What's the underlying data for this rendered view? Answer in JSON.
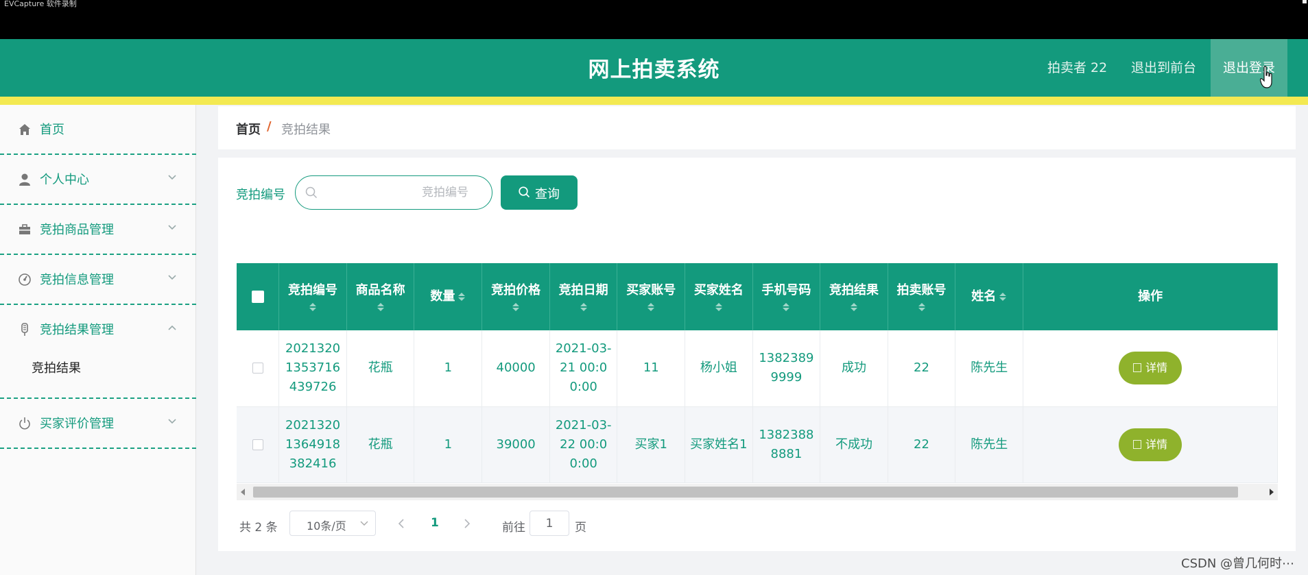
{
  "window": {
    "caption": "EVCapture 软件录制"
  },
  "header": {
    "title": "网上拍卖系统",
    "user_label": "拍卖者 22",
    "back_front": "退出到前台",
    "logout": "退出登录",
    "bg_color": "#139a7d",
    "strip_color": "#f3e952"
  },
  "sidebar": {
    "items": [
      {
        "label": "首页",
        "icon": "home-icon"
      },
      {
        "label": "个人中心",
        "icon": "user-icon"
      },
      {
        "label": "竞拍商品管理",
        "icon": "briefcase-icon"
      },
      {
        "label": "竞拍信息管理",
        "icon": "gauge-icon"
      },
      {
        "label": "竞拍结果管理",
        "icon": "mic-icon"
      },
      {
        "label": "买家评价管理",
        "icon": "power-icon"
      }
    ],
    "subitem": "竞拍结果"
  },
  "breadcrumb": {
    "home": "首页",
    "separator": "/",
    "current": "竞拍结果"
  },
  "search": {
    "label": "竞拍编号",
    "placeholder": "竞拍编号",
    "value": "",
    "button": "查询"
  },
  "table": {
    "headers": {
      "code": "竞拍编号",
      "product": "商品名称",
      "qty": "数量",
      "price": "竞拍价格",
      "date": "竞拍日期",
      "buyer_acct": "买家账号",
      "buyer_name": "买家姓名",
      "phone": "手机号码",
      "result": "竞拍结果",
      "seller_acct": "拍卖账号",
      "name": "姓名",
      "ops": "操作"
    },
    "rows": [
      {
        "code": "20213201353716439726",
        "product": "花瓶",
        "qty": "1",
        "price": "40000",
        "date": "2021-03-21 00:00:00",
        "buyer_acct": "11",
        "buyer_name": "杨小姐",
        "phone": "13823899999",
        "result": "成功",
        "seller_acct": "22",
        "name": "陈先生",
        "action": "详情"
      },
      {
        "code": "20213201364918382416",
        "product": "花瓶",
        "qty": "1",
        "price": "39000",
        "date": "2021-03-22 00:00:00",
        "buyer_acct": "买家1",
        "buyer_name": "买家姓名1",
        "phone": "13823888881",
        "result": "不成功",
        "seller_acct": "22",
        "name": "陈先生",
        "action": "详情"
      }
    ]
  },
  "pagination": {
    "total": "共 2 条",
    "page_size": "10条/页",
    "current": "1",
    "goto_label": "前往",
    "goto_value": "1",
    "page_suffix": "页"
  },
  "watermark": "CSDN @曾几何时⋯"
}
